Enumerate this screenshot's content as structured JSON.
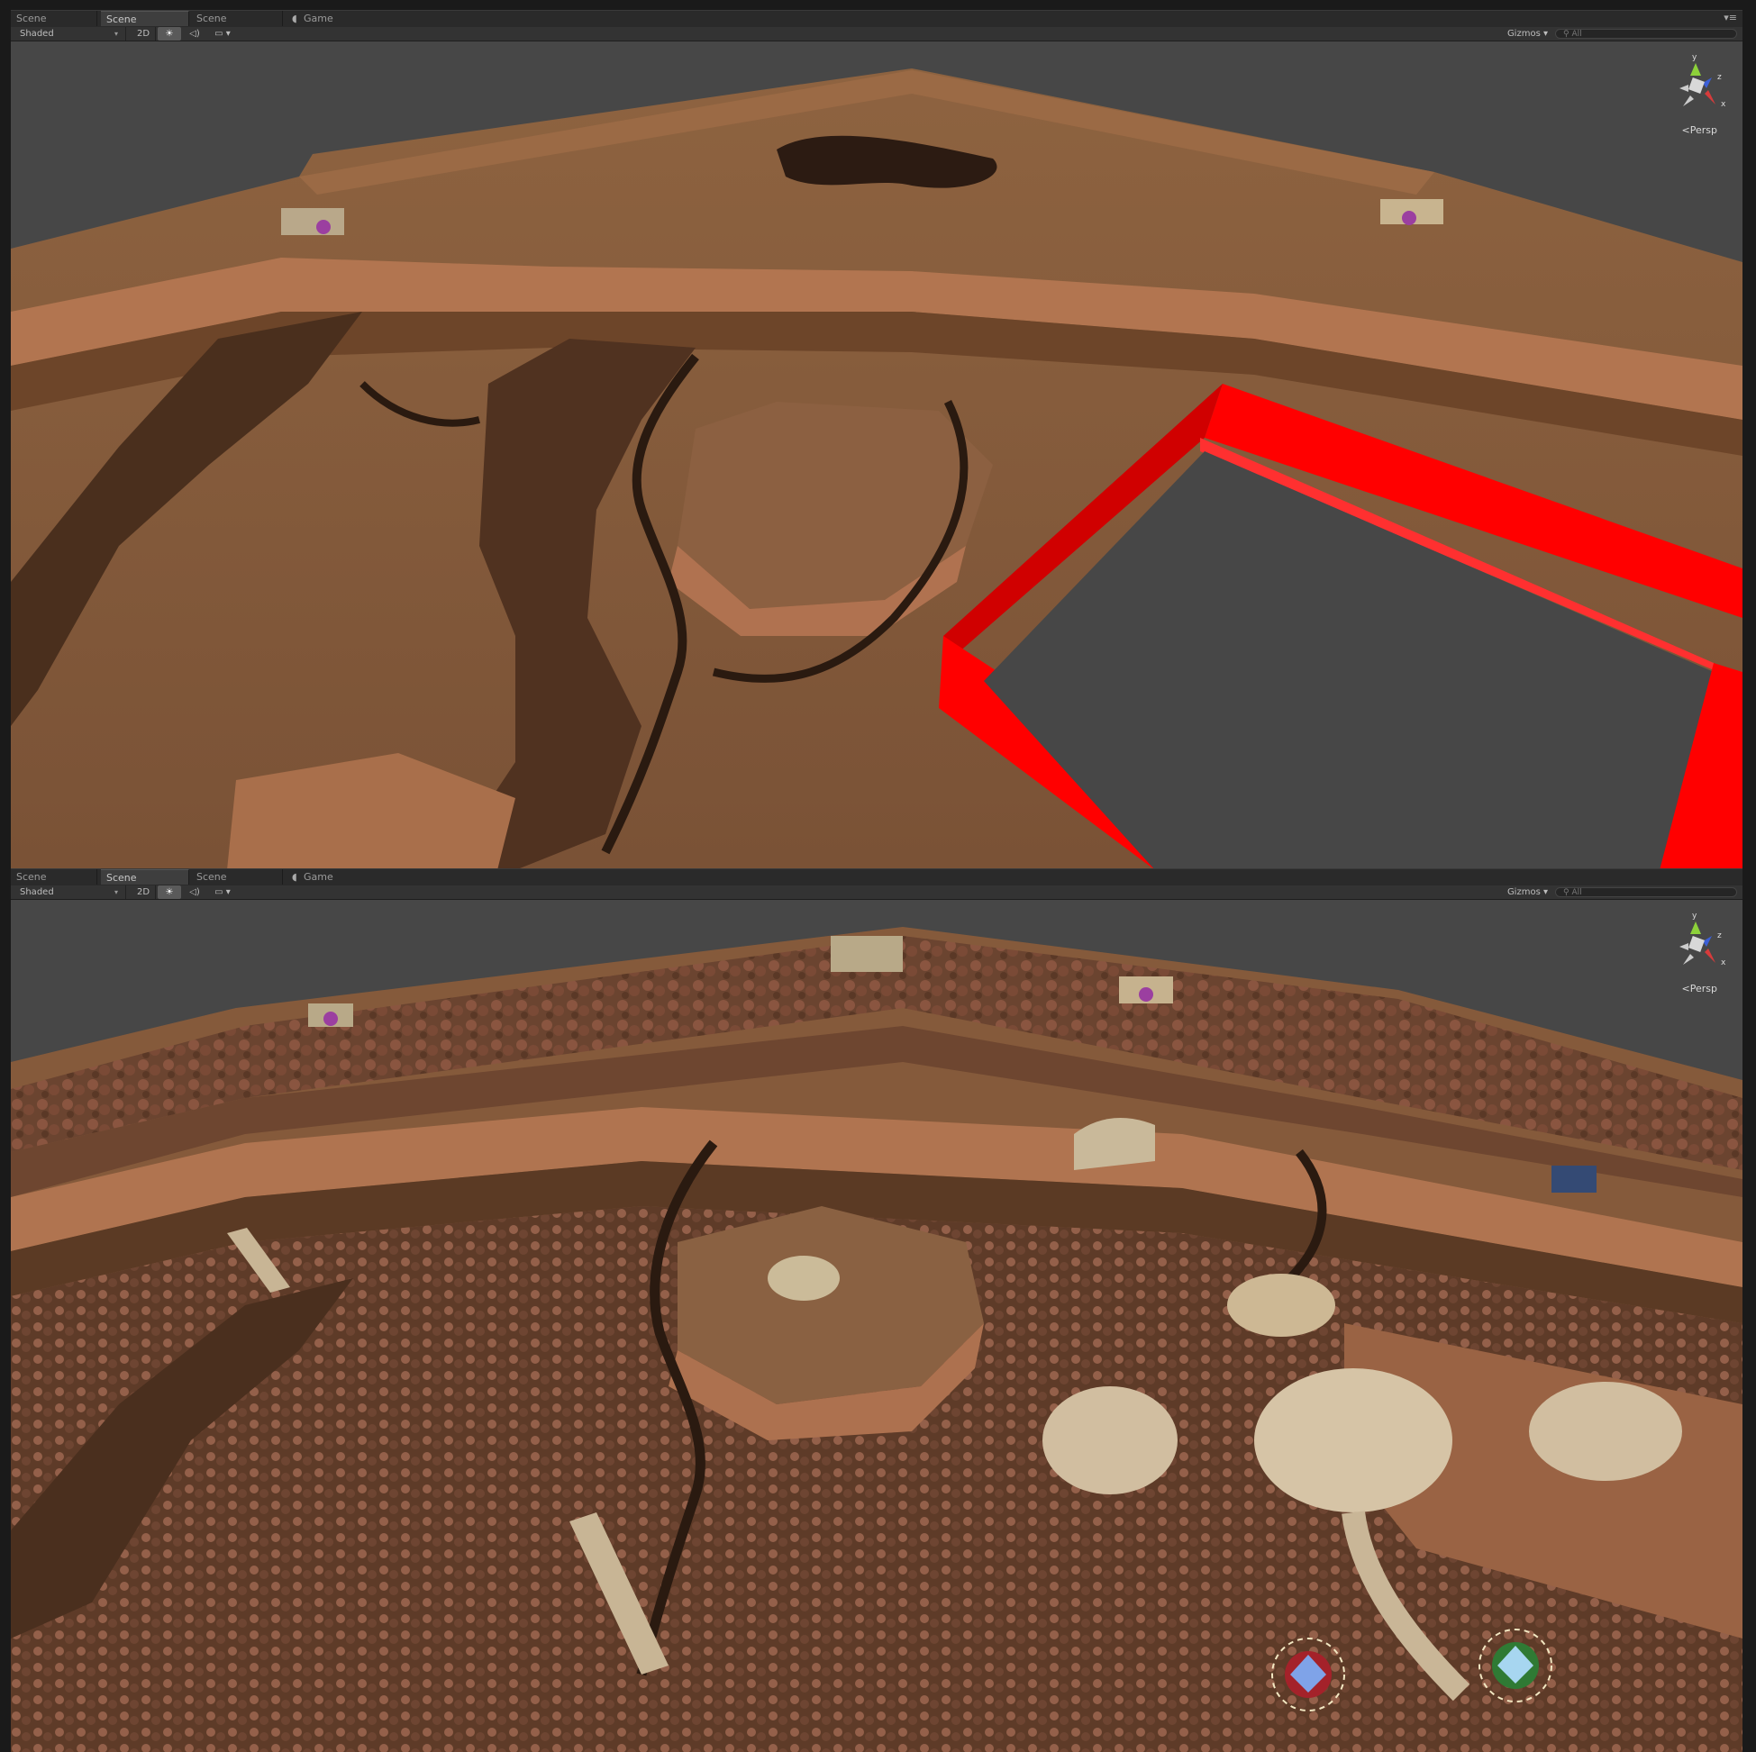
{
  "panels": [
    {
      "tabs": [
        {
          "label": "Scene",
          "active": false
        },
        {
          "label": "Scene",
          "active": true
        },
        {
          "label": "Scene",
          "active": false
        },
        {
          "label": "Game",
          "active": false,
          "icon": "pacman-icon"
        }
      ],
      "toolbar": {
        "shading_mode": "Shaded",
        "toggle_2d": "2D",
        "gizmos_label": "Gizmos",
        "search_placeholder": "All"
      },
      "viewport": {
        "projection_label": "Persp",
        "gizmo_axes": [
          "y",
          "z",
          "x"
        ],
        "content": "canyon terrain (untextured), red boundary box"
      }
    },
    {
      "tabs": [
        {
          "label": "Scene",
          "active": false
        },
        {
          "label": "Scene",
          "active": true
        },
        {
          "label": "Scene",
          "active": false
        },
        {
          "label": "Game",
          "active": false,
          "icon": "pacman-icon"
        }
      ],
      "toolbar": {
        "shading_mode": "Shaded",
        "toggle_2d": "2D",
        "gizmos_label": "Gizmos",
        "search_placeholder": "All"
      },
      "viewport": {
        "projection_label": "Persp",
        "gizmo_axes": [
          "y",
          "z",
          "x"
        ],
        "content": "canyon terrain with trees, ruins and team bases"
      }
    }
  ],
  "colors": {
    "ground": "#8a5c3a",
    "ground_dark": "#5a3a22",
    "cliff": "#b77a52",
    "void": "#464646",
    "boundary": "#ff0000",
    "ruins": "#cdb894",
    "tree": "#7a4a33"
  }
}
